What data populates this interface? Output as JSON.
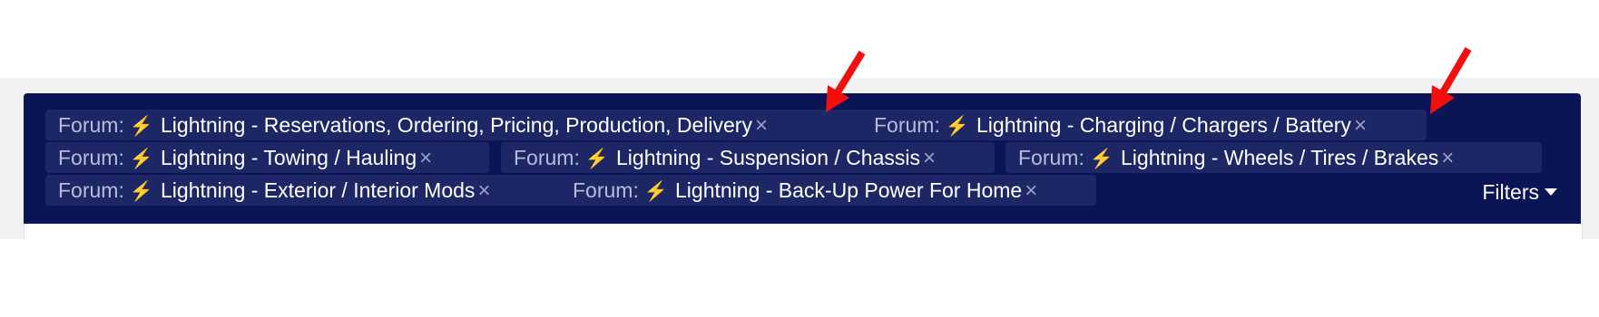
{
  "filters": {
    "chips": [
      {
        "prefix": "Forum:",
        "icon": "lightning-bolt-icon",
        "title": "Lightning - Reservations, Ordering, Pricing, Production, Delivery",
        "remove": "×"
      },
      {
        "prefix": "Forum:",
        "icon": "lightning-bolt-icon",
        "title": "Lightning - Charging / Chargers / Battery",
        "remove": "×"
      },
      {
        "prefix": "Forum:",
        "icon": "lightning-bolt-icon",
        "title": "Lightning - Towing / Hauling",
        "remove": "×"
      },
      {
        "prefix": "Forum:",
        "icon": "lightning-bolt-icon",
        "title": "Lightning - Suspension / Chassis",
        "remove": "×"
      },
      {
        "prefix": "Forum:",
        "icon": "lightning-bolt-icon",
        "title": "Lightning - Wheels / Tires / Brakes",
        "remove": "×"
      },
      {
        "prefix": "Forum:",
        "icon": "lightning-bolt-icon",
        "title": "Lightning - Exterior / Interior Mods",
        "remove": "×"
      },
      {
        "prefix": "Forum:",
        "icon": "lightning-bolt-icon",
        "title": "Lightning - Back-Up Power For Home",
        "remove": "×"
      }
    ],
    "toggle_label": "Filters",
    "bolt_glyph": "⚡"
  },
  "colors": {
    "bar_background": "#0b1555",
    "chip_background": "#1e2766",
    "annotation_arrow": "#f40f0f"
  }
}
